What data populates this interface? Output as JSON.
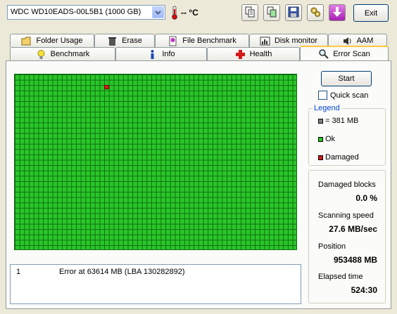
{
  "toolbar": {
    "drive": "WDC WD10EADS-00L5B1 (1000 GB)",
    "temperature": "-- °C",
    "exit_label": "Exit",
    "buttons": [
      "copy-icon",
      "copy-screen-icon",
      "save-icon",
      "options-icon",
      "download-icon"
    ]
  },
  "tabs_row1": [
    {
      "label": "Folder Usage",
      "icon": "folder-icon"
    },
    {
      "label": "Erase",
      "icon": "trash-icon"
    },
    {
      "label": "File Benchmark",
      "icon": "file-benchmark-icon"
    },
    {
      "label": "Disk monitor",
      "icon": "disk-monitor-icon"
    },
    {
      "label": "AAM",
      "icon": "speaker-icon"
    }
  ],
  "tabs_row2": [
    {
      "label": "Benchmark",
      "icon": "lightbulb-icon"
    },
    {
      "label": "Info",
      "icon": "info-icon"
    },
    {
      "label": "Health",
      "icon": "health-cross-icon"
    },
    {
      "label": "Error Scan",
      "icon": "magnifier-icon",
      "active": true
    }
  ],
  "scan": {
    "start_label": "Start",
    "quick_scan_label": "Quick scan",
    "quick_scan_checked": false,
    "log": [
      {
        "index": "1",
        "message": "Error at 63614 MB (LBA 130282892)"
      }
    ]
  },
  "legend": {
    "title": "Legend",
    "block_size": "= 381 MB",
    "ok": "Ok",
    "damaged": "Damaged",
    "colors": {
      "block": "#808080",
      "ok": "#29c629",
      "damaged": "#d81818"
    }
  },
  "stats": {
    "damaged_blocks_label": "Damaged blocks",
    "damaged_blocks_value": "0.0 %",
    "scanning_speed_label": "Scanning speed",
    "scanning_speed_value": "27.6 MB/sec",
    "position_label": "Position",
    "position_value": "953488 MB",
    "elapsed_label": "Elapsed time",
    "elapsed_value": "524:30"
  }
}
